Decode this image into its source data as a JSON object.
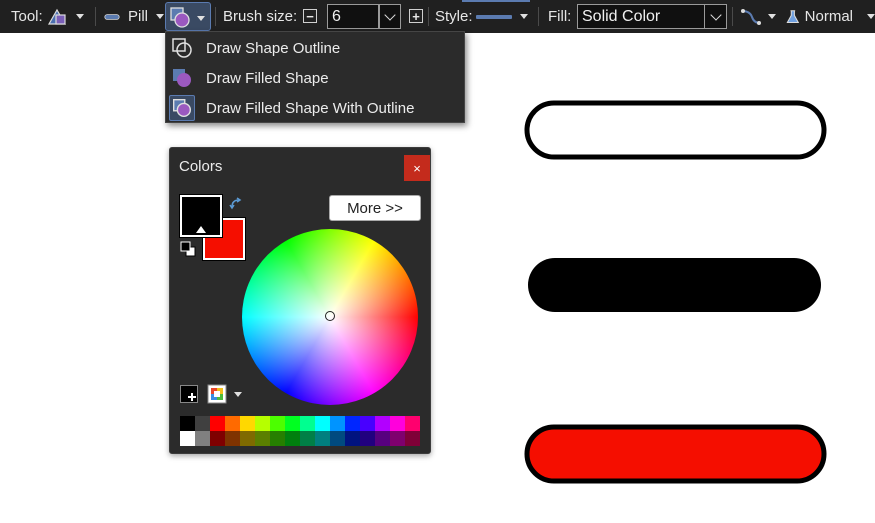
{
  "toolbar": {
    "tool_label": "Tool:",
    "tool_icon": "shapes-icon",
    "shape_label": "Pill",
    "brush_size_label": "Brush size:",
    "brush_size_value": "6",
    "style_label": "Style:",
    "fill_label": "Fill:",
    "fill_value": "Solid Color",
    "blend_label": "Normal",
    "accent": "#5b7bb0"
  },
  "draw_mode_menu": {
    "items": [
      {
        "label": "Draw Shape Outline",
        "icon": "outline-shape-icon",
        "selected": false
      },
      {
        "label": "Draw Filled Shape",
        "icon": "filled-shape-icon",
        "selected": false
      },
      {
        "label": "Draw Filled Shape With Outline",
        "icon": "filled-outline-shape-icon",
        "selected": true
      }
    ]
  },
  "colors_panel": {
    "title": "Colors",
    "close_glyph": "×",
    "more_button": "More >>",
    "primary_color": "#000000",
    "secondary_color": "#f50e00",
    "palette_top": [
      "#000000",
      "#404040",
      "#ff0000",
      "#ff6a00",
      "#ffd800",
      "#b6ff00",
      "#4cff00",
      "#00ff21",
      "#00ff90",
      "#00ffff",
      "#0094ff",
      "#0026ff",
      "#4800ff",
      "#b200ff",
      "#ff00dc",
      "#ff006e"
    ],
    "palette_bottom": [
      "#ffffff",
      "#808080",
      "#7f0000",
      "#7f3300",
      "#7f6a00",
      "#5b7f00",
      "#267f00",
      "#007f0e",
      "#007f46",
      "#007f7f",
      "#004a7f",
      "#00137f",
      "#21007f",
      "#57007f",
      "#7f006e",
      "#7f0037"
    ]
  },
  "canvas": {
    "shapes": [
      {
        "name": "pill-outline",
        "fill": "#ffffff",
        "stroke": "#000000"
      },
      {
        "name": "pill-filled",
        "fill": "#000000",
        "stroke": "none"
      },
      {
        "name": "pill-filled-outline",
        "fill": "#f50e00",
        "stroke": "#000000"
      }
    ]
  }
}
